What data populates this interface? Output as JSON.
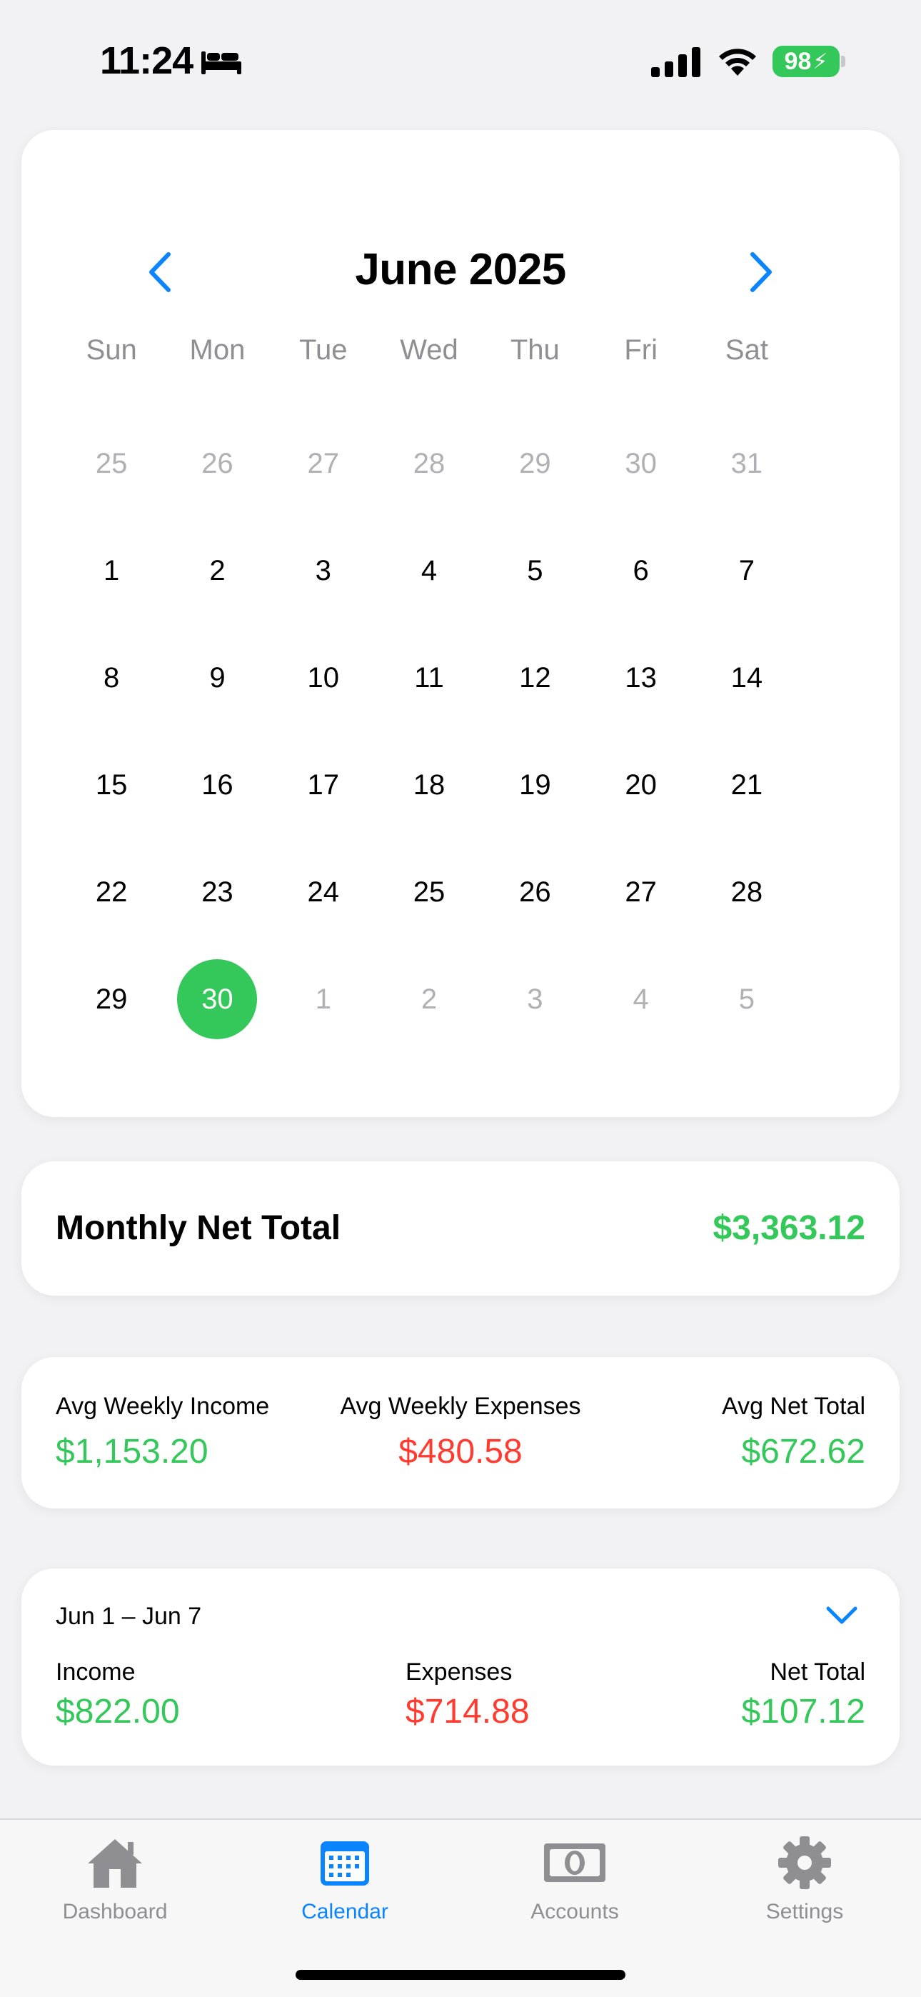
{
  "status": {
    "time": "11:24",
    "battery": "98"
  },
  "calendar": {
    "title": "June 2025",
    "weekdays": [
      "Sun",
      "Mon",
      "Tue",
      "Wed",
      "Thu",
      "Fri",
      "Sat"
    ],
    "weeks": [
      [
        {
          "d": "25",
          "m": true
        },
        {
          "d": "26",
          "m": true
        },
        {
          "d": "27",
          "m": true
        },
        {
          "d": "28",
          "m": true
        },
        {
          "d": "29",
          "m": true
        },
        {
          "d": "30",
          "m": true
        },
        {
          "d": "31",
          "m": true
        }
      ],
      [
        {
          "d": "1"
        },
        {
          "d": "2"
        },
        {
          "d": "3"
        },
        {
          "d": "4"
        },
        {
          "d": "5"
        },
        {
          "d": "6"
        },
        {
          "d": "7"
        }
      ],
      [
        {
          "d": "8"
        },
        {
          "d": "9"
        },
        {
          "d": "10"
        },
        {
          "d": "11"
        },
        {
          "d": "12"
        },
        {
          "d": "13"
        },
        {
          "d": "14"
        }
      ],
      [
        {
          "d": "15"
        },
        {
          "d": "16"
        },
        {
          "d": "17"
        },
        {
          "d": "18"
        },
        {
          "d": "19"
        },
        {
          "d": "20"
        },
        {
          "d": "21"
        }
      ],
      [
        {
          "d": "22"
        },
        {
          "d": "23"
        },
        {
          "d": "24"
        },
        {
          "d": "25"
        },
        {
          "d": "26"
        },
        {
          "d": "27"
        },
        {
          "d": "28"
        }
      ],
      [
        {
          "d": "29"
        },
        {
          "d": "30",
          "s": true
        },
        {
          "d": "1",
          "m": true
        },
        {
          "d": "2",
          "m": true
        },
        {
          "d": "3",
          "m": true
        },
        {
          "d": "4",
          "m": true
        },
        {
          "d": "5",
          "m": true
        }
      ]
    ],
    "selected_color": "#34c759",
    "accent": "#0a84ff"
  },
  "monthly": {
    "label": "Monthly Net Total",
    "value": "$3,363.12"
  },
  "averages": {
    "income_label": "Avg Weekly Income",
    "income_value": "$1,153.20",
    "expenses_label": "Avg Weekly Expenses",
    "expenses_value": "$480.58",
    "net_label": "Avg Net Total",
    "net_value": "$672.62"
  },
  "week": {
    "range": "Jun 1 – Jun 7",
    "income_label": "Income",
    "income_value": "$822.00",
    "expenses_label": "Expenses",
    "expenses_value": "$714.88",
    "net_label": "Net Total",
    "net_value": "$107.12"
  },
  "tabs": [
    {
      "label": "Dashboard",
      "icon": "house-icon"
    },
    {
      "label": "Calendar",
      "icon": "calendar-icon",
      "active": true
    },
    {
      "label": "Accounts",
      "icon": "banknote-icon"
    },
    {
      "label": "Settings",
      "icon": "gear-icon"
    }
  ],
  "colors": {
    "income": "#34c759",
    "expense": "#ff3b30"
  }
}
